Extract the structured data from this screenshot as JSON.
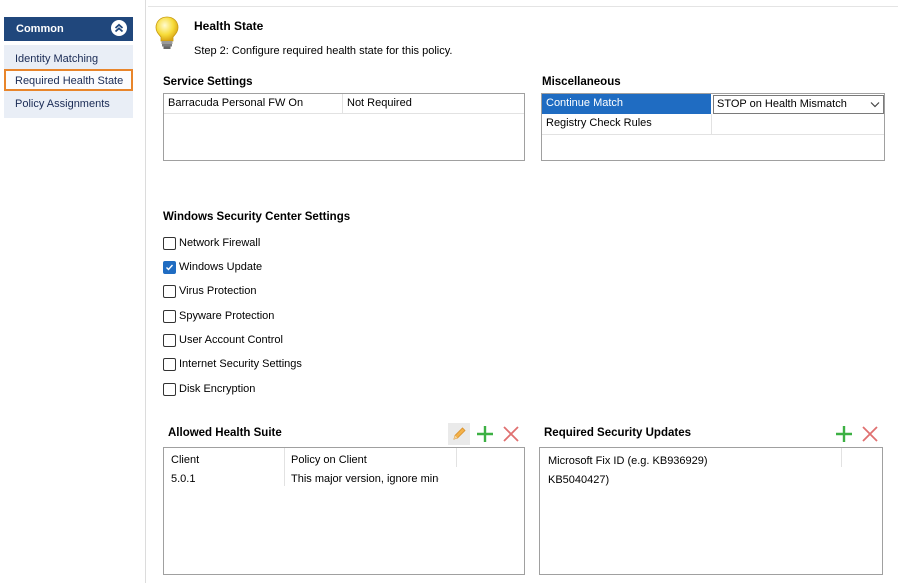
{
  "nav": {
    "header": "Common",
    "items": [
      {
        "label": "Identity Matching"
      },
      {
        "label": "Required Health State"
      },
      {
        "label": "Policy Assignments"
      }
    ]
  },
  "page": {
    "title": "Health State",
    "subtitle": "Step 2: Configure required health state for this policy."
  },
  "service_settings": {
    "title": "Service Settings",
    "rows": [
      {
        "name": "Barracuda Personal FW On",
        "value": "Not Required"
      }
    ]
  },
  "misc": {
    "title": "Miscellaneous",
    "rows": [
      {
        "name": "Continue Match",
        "value": "STOP on Health Mismatch"
      },
      {
        "name": "Registry Check Rules",
        "value": ""
      }
    ]
  },
  "wsc": {
    "title": "Windows Security Center Settings",
    "items": [
      {
        "label": "Network Firewall",
        "checked": false
      },
      {
        "label": "Windows Update",
        "checked": true
      },
      {
        "label": "Virus Protection",
        "checked": false
      },
      {
        "label": "Spyware Protection",
        "checked": false
      },
      {
        "label": "User Account Control",
        "checked": false
      },
      {
        "label": "Internet Security Settings",
        "checked": false
      },
      {
        "label": "Disk Encryption",
        "checked": false
      }
    ]
  },
  "health_suite": {
    "title": "Allowed Health Suite",
    "columns": [
      "Client",
      "Policy on Client"
    ],
    "rows": [
      {
        "client": "5.0.1",
        "policy": "This major version, ignore minor"
      }
    ]
  },
  "security_updates": {
    "title": "Required Security Updates",
    "column": "Microsoft Fix ID (e.g. KB936929)",
    "rows": [
      "KB5040427)"
    ]
  },
  "colors": {
    "nav_header": "#20477c",
    "nav_selected_border": "#e8852b",
    "selection": "#1f6cc2",
    "add_green": "#3cb043",
    "delete_red": "#e05a5a",
    "edit_orange": "#f0a030"
  }
}
